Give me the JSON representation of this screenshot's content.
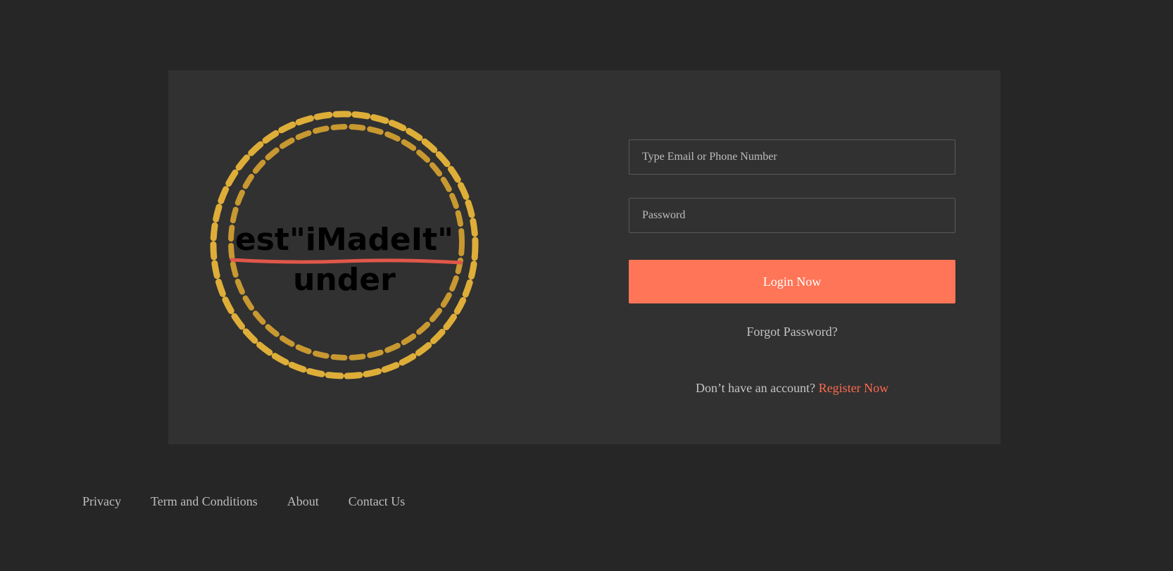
{
  "logo": {
    "line1": "est\"iMadeIt\"",
    "line2": "under",
    "ring_color": "#e8b53a",
    "strike_color": "#e0574a"
  },
  "form": {
    "email_placeholder": "Type Email or Phone Number",
    "password_placeholder": "Password",
    "login_label": "Login Now",
    "forgot_label": "Forgot Password?",
    "register_prompt": "Don’t have an account?",
    "register_label": "Register Now"
  },
  "footer": {
    "links": [
      "Privacy",
      "Term and Conditions",
      "About",
      "Contact Us"
    ]
  },
  "colors": {
    "page_bg": "#262626",
    "card_bg": "#313131",
    "accent": "#ff7557"
  }
}
